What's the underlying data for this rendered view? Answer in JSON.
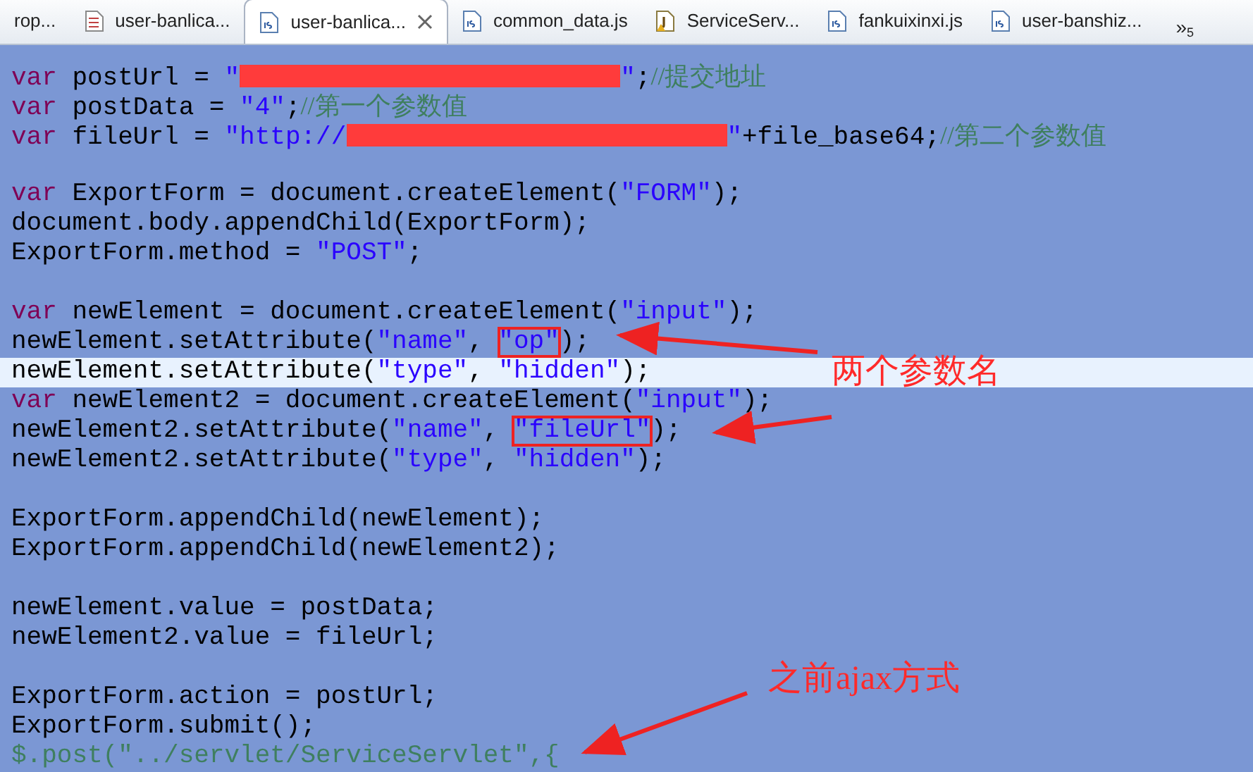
{
  "tabs": [
    {
      "label": "rop...",
      "kind": "plain",
      "selected": false
    },
    {
      "label": "user-banlica...",
      "kind": "document",
      "selected": false
    },
    {
      "label": "user-banlica...",
      "kind": "script",
      "selected": true
    },
    {
      "label": "common_data.js",
      "kind": "script",
      "selected": false
    },
    {
      "label": "ServiceServ...",
      "kind": "java",
      "selected": false
    },
    {
      "label": "fankuixinxi.js",
      "kind": "script",
      "selected": false
    },
    {
      "label": "user-banshiz...",
      "kind": "script",
      "selected": false
    }
  ],
  "overflow": {
    "label": "»",
    "count": "5"
  },
  "code_lines": [
    {
      "kind": "code",
      "current": false,
      "tokens": [
        {
          "kind": "keyword",
          "text": "var"
        },
        {
          "kind": "plain",
          "text": " postUrl = "
        },
        {
          "kind": "string",
          "text": "\""
        },
        {
          "kind": "redacted"
        },
        {
          "kind": "string",
          "text": "\""
        },
        {
          "kind": "plain",
          "text": ";"
        },
        {
          "kind": "comment",
          "text": "//提交地址"
        }
      ]
    },
    {
      "kind": "code",
      "current": false,
      "tokens": [
        {
          "kind": "keyword",
          "text": "var"
        },
        {
          "kind": "plain",
          "text": " postData = "
        },
        {
          "kind": "string",
          "text": "\"4\""
        },
        {
          "kind": "plain",
          "text": ";"
        },
        {
          "kind": "comment",
          "text": "//第一个参数值"
        }
      ]
    },
    {
      "kind": "code",
      "current": false,
      "tokens": [
        {
          "kind": "keyword",
          "text": "var"
        },
        {
          "kind": "plain",
          "text": " fileUrl = "
        },
        {
          "kind": "string",
          "text": "\"http://"
        },
        {
          "kind": "redacted"
        },
        {
          "kind": "string",
          "text": "\""
        },
        {
          "kind": "plain",
          "text": "+file_base64;"
        },
        {
          "kind": "comment",
          "text": "//第二个参数值"
        }
      ]
    },
    {
      "kind": "blank"
    },
    {
      "kind": "code",
      "current": false,
      "tokens": [
        {
          "kind": "keyword",
          "text": "var"
        },
        {
          "kind": "plain",
          "text": " ExportForm = document.createElement("
        },
        {
          "kind": "string",
          "text": "\"FORM\""
        },
        {
          "kind": "plain",
          "text": ");"
        }
      ]
    },
    {
      "kind": "code",
      "current": false,
      "tokens": [
        {
          "kind": "plain",
          "text": "document.body.appendChild(ExportForm);"
        }
      ]
    },
    {
      "kind": "code",
      "current": false,
      "tokens": [
        {
          "kind": "plain",
          "text": "ExportForm.method = "
        },
        {
          "kind": "string",
          "text": "\"POST\""
        },
        {
          "kind": "plain",
          "text": ";"
        }
      ]
    },
    {
      "kind": "blank"
    },
    {
      "kind": "code",
      "current": false,
      "tokens": [
        {
          "kind": "keyword",
          "text": "var"
        },
        {
          "kind": "plain",
          "text": " newElement = document.createElement("
        },
        {
          "kind": "string",
          "text": "\"input\""
        },
        {
          "kind": "plain",
          "text": ");"
        }
      ]
    },
    {
      "kind": "code",
      "current": false,
      "tokens": [
        {
          "kind": "plain",
          "text": "newElement.setAttribute("
        },
        {
          "kind": "string",
          "text": "\"name\""
        },
        {
          "kind": "plain",
          "text": ", "
        },
        {
          "kind": "string",
          "text": "\"op\"",
          "boxed": true
        },
        {
          "kind": "plain",
          "text": ");"
        }
      ]
    },
    {
      "kind": "code",
      "current": true,
      "tokens": [
        {
          "kind": "plain",
          "text": "newElement.setAttribute("
        },
        {
          "kind": "string",
          "text": "\"type\""
        },
        {
          "kind": "plain",
          "text": ", "
        },
        {
          "kind": "string",
          "text": "\"hidden\""
        },
        {
          "kind": "plain",
          "text": ");"
        }
      ]
    },
    {
      "kind": "code",
      "current": false,
      "tokens": [
        {
          "kind": "keyword",
          "text": "var"
        },
        {
          "kind": "plain",
          "text": " newElement2 = document.createElement("
        },
        {
          "kind": "string",
          "text": "\"input\""
        },
        {
          "kind": "plain",
          "text": ");"
        }
      ]
    },
    {
      "kind": "code",
      "current": false,
      "tokens": [
        {
          "kind": "plain",
          "text": "newElement2.setAttribute("
        },
        {
          "kind": "string",
          "text": "\"name\""
        },
        {
          "kind": "plain",
          "text": ", "
        },
        {
          "kind": "string",
          "text": "\"fileUrl\"",
          "boxed": true
        },
        {
          "kind": "plain",
          "text": ");"
        }
      ]
    },
    {
      "kind": "code",
      "current": false,
      "tokens": [
        {
          "kind": "plain",
          "text": "newElement2.setAttribute("
        },
        {
          "kind": "string",
          "text": "\"type\""
        },
        {
          "kind": "plain",
          "text": ", "
        },
        {
          "kind": "string",
          "text": "\"hidden\""
        },
        {
          "kind": "plain",
          "text": ");"
        }
      ]
    },
    {
      "kind": "blank"
    },
    {
      "kind": "code",
      "current": false,
      "tokens": [
        {
          "kind": "plain",
          "text": "ExportForm.appendChild(newElement);"
        }
      ]
    },
    {
      "kind": "code",
      "current": false,
      "tokens": [
        {
          "kind": "plain",
          "text": "ExportForm.appendChild(newElement2);"
        }
      ]
    },
    {
      "kind": "blank"
    },
    {
      "kind": "code",
      "current": false,
      "tokens": [
        {
          "kind": "plain",
          "text": "newElement.value = postData;"
        }
      ]
    },
    {
      "kind": "code",
      "current": false,
      "tokens": [
        {
          "kind": "plain",
          "text": "newElement2.value = fileUrl;"
        }
      ]
    },
    {
      "kind": "blank"
    },
    {
      "kind": "code",
      "current": false,
      "tokens": [
        {
          "kind": "plain",
          "text": "ExportForm.action = postUrl;"
        }
      ]
    },
    {
      "kind": "code",
      "current": false,
      "tokens": [
        {
          "kind": "plain",
          "text": "ExportForm.submit();"
        }
      ]
    },
    {
      "kind": "code",
      "current": false,
      "tokens": [
        {
          "kind": "comment",
          "text": "$.post(\"../servlet/ServiceServlet\",{"
        }
      ]
    }
  ],
  "annotations": [
    {
      "text": "两个参数名"
    },
    {
      "text": "之前ajax方式"
    }
  ]
}
